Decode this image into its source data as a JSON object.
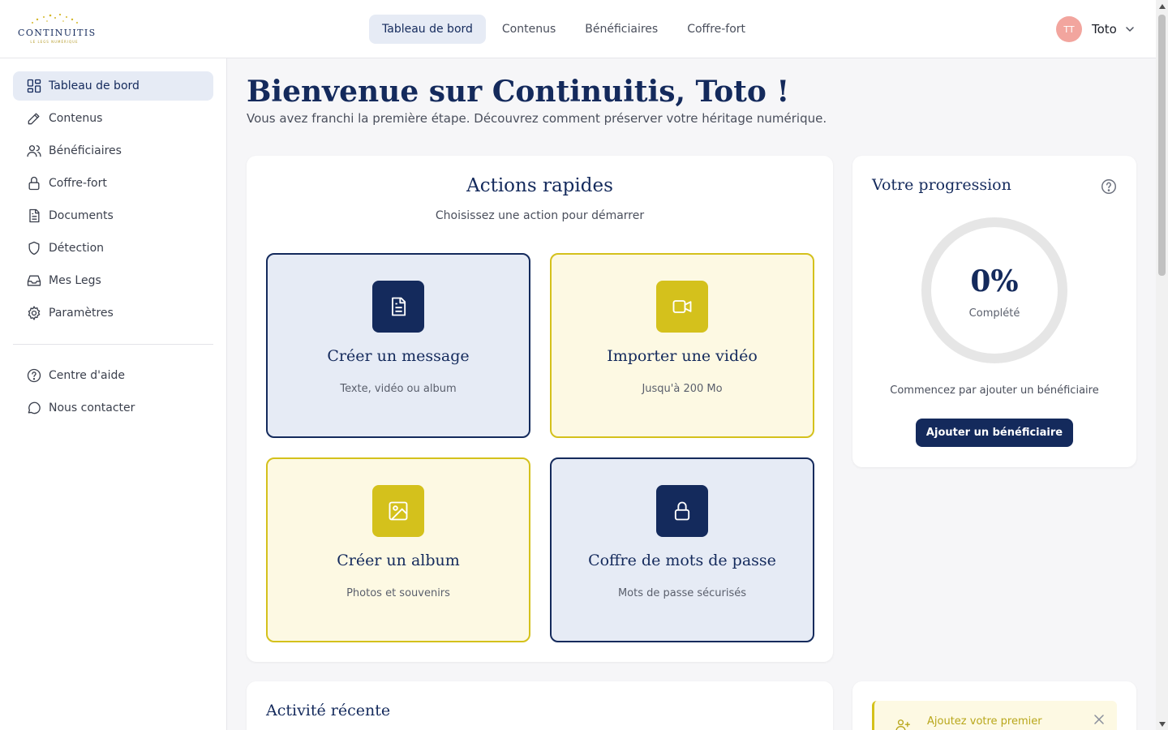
{
  "app": {
    "logo_text": "CONTINUITIS",
    "logo_sub": "LE LEGS NUMÉRIQUE"
  },
  "topnav": {
    "items": [
      {
        "label": "Tableau de bord"
      },
      {
        "label": "Contenus"
      },
      {
        "label": "Bénéficiaires"
      },
      {
        "label": "Coffre-fort"
      }
    ],
    "active": "Tableau de bord"
  },
  "user": {
    "initials": "TT",
    "name": "Toto"
  },
  "sidebar": {
    "items": [
      {
        "label": "Tableau de bord",
        "icon": "dashboard-icon"
      },
      {
        "label": "Contenus",
        "icon": "pencil-icon"
      },
      {
        "label": "Bénéficiaires",
        "icon": "users-icon"
      },
      {
        "label": "Coffre-fort",
        "icon": "lock-icon"
      },
      {
        "label": "Documents",
        "icon": "document-icon"
      },
      {
        "label": "Détection",
        "icon": "shield-icon"
      },
      {
        "label": "Mes Legs",
        "icon": "inbox-icon"
      },
      {
        "label": "Paramètres",
        "icon": "gear-icon"
      }
    ],
    "secondary": [
      {
        "label": "Centre d'aide",
        "icon": "help-circle-icon"
      },
      {
        "label": "Nous contacter",
        "icon": "chat-icon"
      }
    ]
  },
  "main": {
    "welcome": "Bienvenue sur Continuitis, Toto !",
    "welcome_sub": "Vous avez franchi la première étape. Découvrez comment préserver votre héritage numérique."
  },
  "actions": {
    "title": "Actions rapides",
    "subtitle": "Choisissez une action pour démarrer",
    "tiles": [
      {
        "title": "Créer un message",
        "subtitle": "Texte, vidéo ou album",
        "icon": "file-text-icon",
        "variant": "blue"
      },
      {
        "title": "Importer une vidéo",
        "subtitle": "Jusqu'à 200 Mo",
        "icon": "video-icon",
        "variant": "yellow"
      },
      {
        "title": "Créer un album",
        "subtitle": "Photos et souvenirs",
        "icon": "image-icon",
        "variant": "yellow"
      },
      {
        "title": "Coffre de mots de passe",
        "subtitle": "Mots de passe sécurisés",
        "icon": "lock-icon",
        "variant": "blue"
      }
    ]
  },
  "progress": {
    "title": "Votre progression",
    "percent": "0%",
    "value": 0,
    "label": "Complété",
    "hint": "Commencez par ajouter un bénéficiaire",
    "button": "Ajouter un bénéficiaire"
  },
  "activity": {
    "title": "Activité récente"
  },
  "tip": {
    "text": "Ajoutez votre premier"
  },
  "colors": {
    "navy": "#142a5c",
    "gold": "#d4c11c",
    "light_blue": "#e6ebf5",
    "light_yellow": "#fdf9e3",
    "avatar": "#f2a59e"
  }
}
